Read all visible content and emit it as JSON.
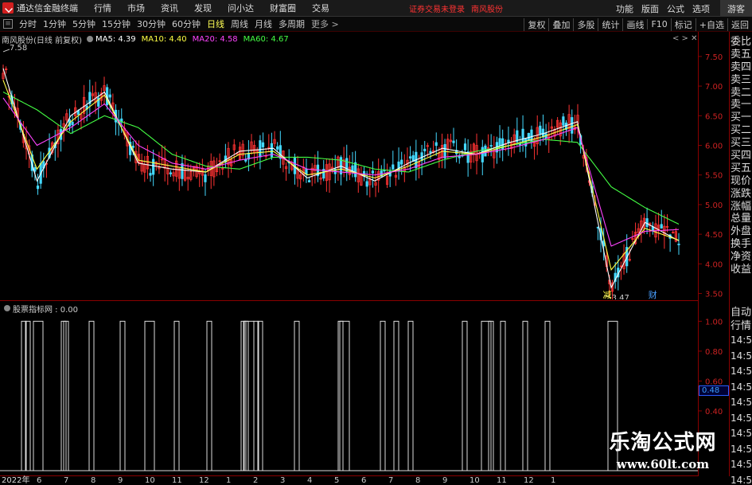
{
  "app": {
    "title": "通达信金融终端",
    "menus": [
      "行情",
      "市场",
      "资讯",
      "发现",
      "问小达",
      "财富圈",
      "交易"
    ],
    "notice": "证券交易未登录",
    "stock_name": "南风股份",
    "right_menus": [
      "功能",
      "版面",
      "公式",
      "选项"
    ],
    "guest": "游客"
  },
  "toolbar": {
    "periods": [
      "分时",
      "1分钟",
      "5分钟",
      "15分钟",
      "30分钟",
      "60分钟",
      "日线",
      "周线",
      "月线",
      "多周期",
      "更多"
    ],
    "active_period": "日线",
    "right_tools": [
      "复权",
      "叠加",
      "多股",
      "统计",
      "画线",
      "F10",
      "标记",
      "+自选",
      "返回"
    ]
  },
  "main_chart": {
    "header_name": "南风股份(日线 前复权)",
    "ma": [
      {
        "label": "MA5: 4.39",
        "color": "#ffffff"
      },
      {
        "label": "MA10: 4.40",
        "color": "#ffff44"
      },
      {
        "label": "MA20: 4.58",
        "color": "#ff44ff"
      },
      {
        "label": "MA60: 4.67",
        "color": "#44ff44"
      }
    ],
    "window_controls": "< >",
    "high_label": "7.58",
    "low_label": "3.47",
    "y_ticks": [
      "7.50",
      "7.00",
      "6.50",
      "6.00",
      "5.50",
      "5.00",
      "4.50",
      "4.00",
      "3.50"
    ],
    "badges": [
      "减",
      "财"
    ],
    "badge_colors": {
      "reduce": "#ffff44",
      "finance": "#4aa0ff"
    }
  },
  "side_panel": {
    "labels": [
      "委比",
      "卖五",
      "卖四",
      "卖三",
      "卖二",
      "卖一",
      "买一",
      "买二",
      "买三",
      "买四",
      "买五",
      "现价",
      "涨跌",
      "涨幅",
      "总量",
      "外盘",
      "换手",
      "净资",
      "收益"
    ],
    "labels2": [
      "自动",
      "行情"
    ],
    "times": [
      "14:50",
      "14:50",
      "14:50",
      "14:50",
      "14:50",
      "14:50",
      "14:50",
      "14:50",
      "14:50",
      "14:50"
    ]
  },
  "indicator": {
    "name": "股票指标网 : 0.00",
    "y_ticks": [
      "1.00",
      "0.80",
      "0.60",
      "0.40"
    ],
    "current_value": "0.48"
  },
  "date_axis": {
    "labels": [
      {
        "text": "2022年",
        "year": true
      },
      {
        "text": "6"
      },
      {
        "text": "7"
      },
      {
        "text": "8"
      },
      {
        "text": "9"
      },
      {
        "text": "10"
      },
      {
        "text": "11"
      },
      {
        "text": "12"
      },
      {
        "text": "1"
      },
      {
        "text": "2"
      },
      {
        "text": "3"
      },
      {
        "text": "4"
      },
      {
        "text": "5"
      },
      {
        "text": "6"
      },
      {
        "text": "7"
      },
      {
        "text": "8"
      },
      {
        "text": "9"
      },
      {
        "text": "10"
      },
      {
        "text": "11"
      },
      {
        "text": "12"
      },
      {
        "text": "1"
      }
    ]
  },
  "watermark": {
    "title": "乐淘公式网",
    "url": "www.60lt.com"
  },
  "chart_data": [
    {
      "type": "line",
      "subtype": "candlestick",
      "title": "南风股份(日线 前复权)",
      "ylim": [
        3.4,
        7.7
      ],
      "series": [
        {
          "name": "MA60",
          "color": "#44ff44",
          "x": [
            0,
            1,
            2,
            3,
            4,
            5,
            6,
            7,
            8,
            9,
            10,
            11,
            12,
            13,
            14,
            15,
            16,
            17,
            18,
            19,
            20
          ],
          "values": [
            6.9,
            6.6,
            6.2,
            6.5,
            6.3,
            5.85,
            5.65,
            5.6,
            5.8,
            5.8,
            5.75,
            5.6,
            5.55,
            5.75,
            5.9,
            6.0,
            6.1,
            6.05,
            5.3,
            4.95,
            4.67
          ]
        },
        {
          "name": "MA5",
          "color": "#ffffff",
          "x": [
            0,
            1,
            2,
            3,
            4,
            5,
            6,
            7,
            8,
            9,
            10,
            11,
            12,
            13,
            14,
            15,
            16,
            17,
            18,
            19,
            20
          ],
          "values": [
            7.3,
            5.4,
            6.5,
            6.9,
            5.7,
            5.6,
            5.55,
            5.9,
            5.95,
            5.45,
            5.65,
            5.4,
            5.7,
            5.95,
            5.85,
            6.05,
            6.2,
            6.4,
            3.6,
            4.7,
            4.39
          ]
        },
        {
          "name": "MA10",
          "color": "#ffff44",
          "x": [
            0,
            1,
            2,
            3,
            4,
            5,
            6,
            7,
            8,
            9,
            10,
            11,
            12,
            13,
            14,
            15,
            16,
            17,
            18,
            19,
            20
          ],
          "values": [
            7.1,
            5.6,
            6.4,
            6.85,
            5.75,
            5.65,
            5.55,
            5.85,
            5.9,
            5.5,
            5.6,
            5.45,
            5.65,
            5.9,
            5.85,
            6.0,
            6.15,
            6.35,
            3.9,
            4.6,
            4.4
          ]
        },
        {
          "name": "MA20",
          "color": "#ff44ff",
          "x": [
            0,
            1,
            2,
            3,
            4,
            5,
            6,
            7,
            8,
            9,
            10,
            11,
            12,
            13,
            14,
            15,
            16,
            17,
            18,
            19,
            20
          ],
          "values": [
            6.8,
            6.0,
            6.3,
            6.7,
            6.0,
            5.7,
            5.6,
            5.75,
            5.85,
            5.6,
            5.55,
            5.5,
            5.6,
            5.8,
            5.85,
            5.95,
            6.1,
            6.3,
            4.3,
            4.55,
            4.58
          ]
        }
      ],
      "highest": 7.58,
      "lowest": 3.47
    },
    {
      "type": "line",
      "title": "股票指标网",
      "ylim": [
        0,
        1.05
      ],
      "series": [
        {
          "name": "股票指标网",
          "color": "#dddddd",
          "spike_dates": [
            30,
            35,
            48,
            80,
            83,
            115,
            154,
            188,
            222,
            263,
            306,
            309,
            313,
            322,
            327,
            373,
            428,
            433,
            481,
            498,
            516,
            584,
            611,
            617,
            632,
            660,
            688,
            770
          ],
          "spike_value": 1.0
        }
      ]
    }
  ]
}
